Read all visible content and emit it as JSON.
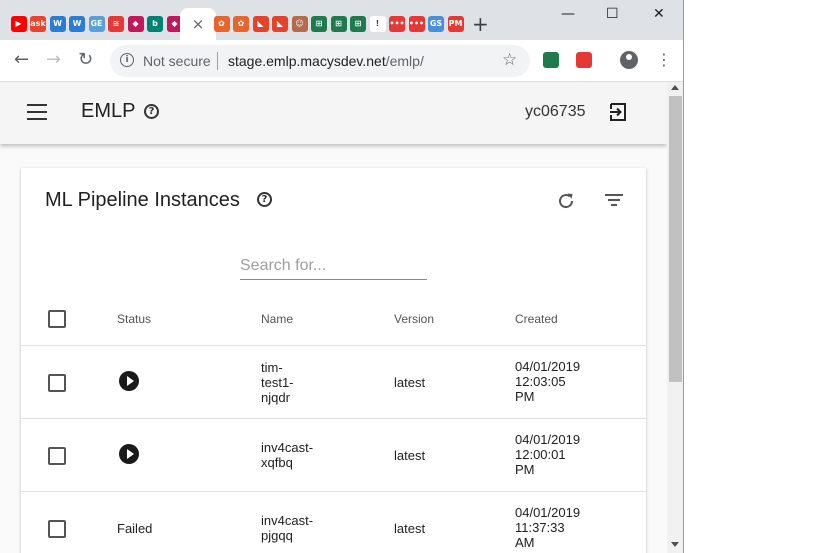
{
  "browser": {
    "tabs": [
      {
        "icon": "youtube-icon",
        "color": "#ff0000",
        "glyph": "▶"
      },
      {
        "icon": "ask-icon",
        "color": "#e8442e",
        "glyph": "ask"
      },
      {
        "icon": "word-doc-icon",
        "color": "#2b7cd3",
        "glyph": "W"
      },
      {
        "icon": "word-doc-icon",
        "color": "#2b7cd3",
        "glyph": "W"
      },
      {
        "icon": "ge-icon",
        "color": "#5aa0d8",
        "glyph": "GE"
      },
      {
        "icon": "wifi-app-icon",
        "color": "#e53935",
        "glyph": "≋"
      },
      {
        "icon": "cube-app-icon",
        "color": "#c2185b",
        "glyph": "◆"
      },
      {
        "icon": "bing-icon",
        "color": "#008373",
        "glyph": "b"
      },
      {
        "icon": "cube-app-icon",
        "color": "#c2185b",
        "glyph": "◆"
      }
    ],
    "active_tab_close": "×",
    "tabs_after": [
      {
        "icon": "gear-app-icon",
        "color": "#e8642e",
        "glyph": "✿"
      },
      {
        "icon": "gear-app-icon",
        "color": "#e8642e",
        "glyph": "✿"
      },
      {
        "icon": "gitlab-icon",
        "color": "#e24329",
        "glyph": "◣"
      },
      {
        "icon": "gitlab-icon",
        "color": "#e24329",
        "glyph": "◣"
      },
      {
        "icon": "jenkins-icon",
        "color": "#b56a49",
        "glyph": "☺"
      },
      {
        "icon": "grid-app-icon",
        "color": "#1f7a4d",
        "glyph": "⊞"
      },
      {
        "icon": "grid-app-icon",
        "color": "#1f7a4d",
        "glyph": "⊞"
      },
      {
        "icon": "grid-app-icon",
        "color": "#1f7a4d",
        "glyph": "⊞"
      },
      {
        "icon": "bookmark-icon",
        "color": "#ffffff",
        "glyph": "!"
      },
      {
        "icon": "dots-app-icon",
        "color": "#e53935",
        "glyph": "•••"
      },
      {
        "icon": "dots-app-icon",
        "color": "#e53935",
        "glyph": "•••"
      },
      {
        "icon": "gs-app-icon",
        "color": "#4a90d9",
        "glyph": "GS"
      },
      {
        "icon": "pm-app-icon",
        "color": "#e53935",
        "glyph": "PM"
      }
    ],
    "new_tab": "+",
    "window_controls": {
      "minimize": "—",
      "maximize": "☐",
      "close": "✕"
    },
    "address": {
      "security_label": "Not secure",
      "host": "stage.emlp.macysdev.net",
      "path": "/emlp/"
    },
    "extensions": [
      {
        "icon": "grid-extension-icon",
        "color": "#1f7a4d"
      },
      {
        "icon": "dots-extension-icon",
        "color": "#e53935"
      }
    ]
  },
  "app": {
    "title": "EMLP",
    "user": "yc06735"
  },
  "card": {
    "title": "ML Pipeline Instances",
    "search_placeholder": "Search for...",
    "columns": [
      "Status",
      "Name",
      "Version",
      "Created"
    ],
    "rows": [
      {
        "status": "running",
        "status_text": "",
        "name": "tim-\ntest1-\nnjqdr",
        "version": "latest",
        "created": "04/01/2019\n12:03:05\nPM"
      },
      {
        "status": "running",
        "status_text": "",
        "name": "inv4cast-\nxqfbq",
        "version": "latest",
        "created": "04/01/2019\n12:00:01\nPM"
      },
      {
        "status": "failed",
        "status_text": "Failed",
        "name": "inv4cast-\npjgqq",
        "version": "latest",
        "created": "04/01/2019\n11:37:33\nAM"
      }
    ]
  }
}
